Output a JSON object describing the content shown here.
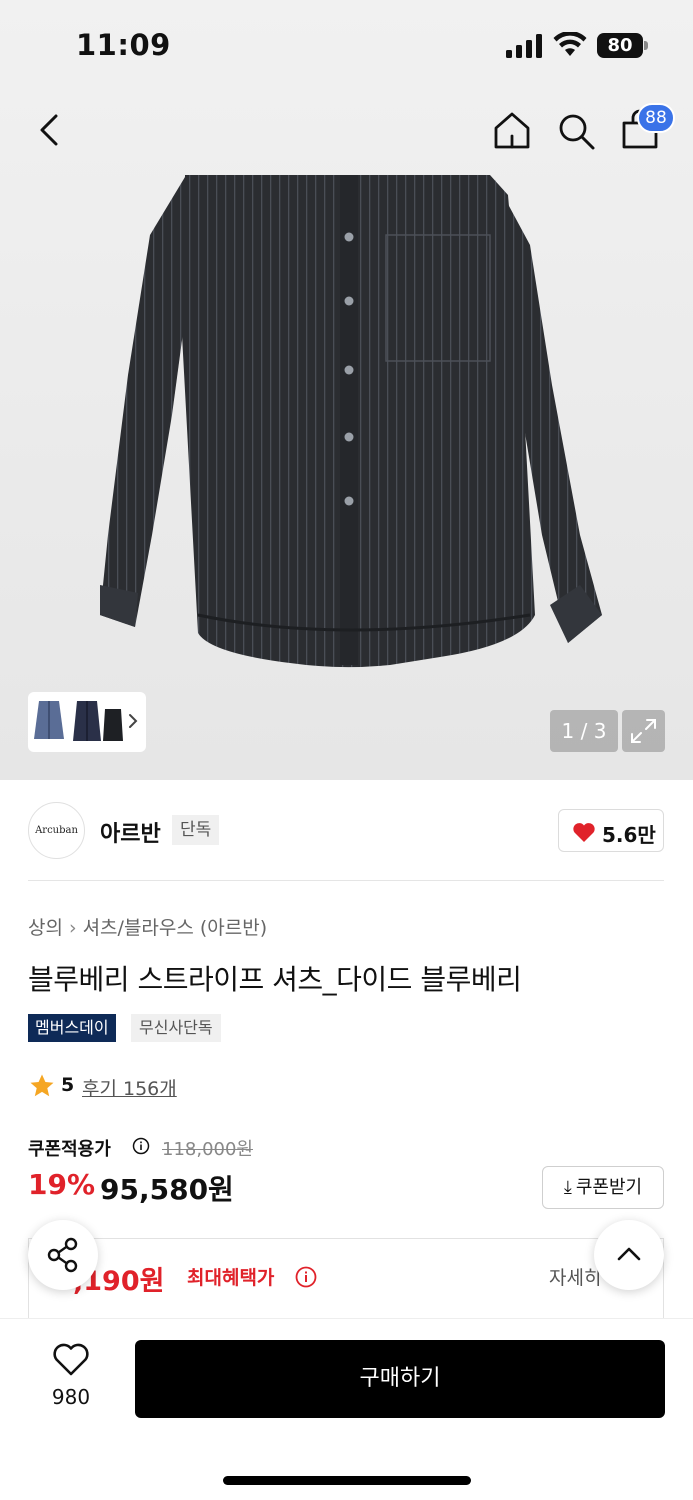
{
  "status_bar": {
    "time": "11:09",
    "battery": "80"
  },
  "header": {
    "cart_count": "88",
    "icons": [
      "back-icon",
      "home-icon",
      "search-icon",
      "cart-icon"
    ]
  },
  "gallery": {
    "page": "1 / 3"
  },
  "brand": {
    "logo_text": "Arcuban",
    "name": "아르반",
    "tag": "단독",
    "likes": "5.6만"
  },
  "breadcrumb": {
    "category": "상의",
    "subcategory": "셔츠/블라우스 (아르반)"
  },
  "product": {
    "title": "블루베리 스트라이프 셔츠_다이드 블루베리",
    "tags": [
      "멤버스데이",
      "무신사단독"
    ],
    "rating": "5",
    "reviews": "후기 156개"
  },
  "price": {
    "coupon_label": "쿠폰적용가",
    "original": "118,000원",
    "discount": "19%",
    "final": "95,580원",
    "coupon_button": "쿠폰받기"
  },
  "benefit": {
    "price": ",190원",
    "label": "최대혜택가",
    "detail": "자세히"
  },
  "bottom_bar": {
    "wish_count": "980",
    "buy_label": "구매하기"
  },
  "colors": {
    "accent_red": "#e0222a",
    "badge_blue": "#3a73e8",
    "tag_navy": "#0e2a57"
  }
}
